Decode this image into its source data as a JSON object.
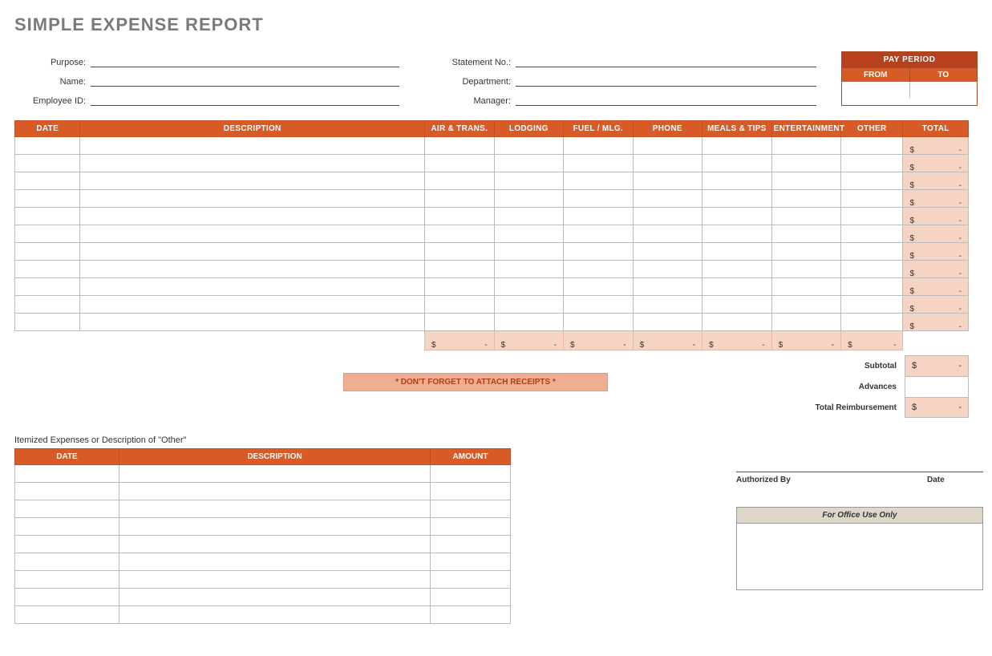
{
  "title": "SIMPLE EXPENSE REPORT",
  "meta": {
    "left": [
      {
        "label": "Purpose:"
      },
      {
        "label": "Name:"
      },
      {
        "label": "Employee ID:"
      }
    ],
    "right": [
      {
        "label": "Statement No.:"
      },
      {
        "label": "Department:"
      },
      {
        "label": "Manager:"
      }
    ]
  },
  "pay_period": {
    "title": "PAY PERIOD",
    "from_label": "FROM",
    "to_label": "TO"
  },
  "main_headers": {
    "date": "DATE",
    "description": "DESCRIPTION",
    "air": "AIR & TRANS.",
    "lodging": "LODGING",
    "fuel": "FUEL / MLG.",
    "phone": "PHONE",
    "meals": "MEALS & TIPS",
    "entertainment": "ENTERTAINMENT",
    "other": "OTHER",
    "total": "TOTAL"
  },
  "currency_symbol": "$",
  "dash": "-",
  "reminder": "* DON'T FORGET TO ATTACH RECEIPTS *",
  "summary": {
    "subtotal": "Subtotal",
    "advances": "Advances",
    "total_reimbursement": "Total Reimbursement"
  },
  "itemized_title": "Itemized Expenses or Description of \"Other\"",
  "item_headers": {
    "date": "DATE",
    "description": "DESCRIPTION",
    "amount": "AMOUNT"
  },
  "auth": {
    "by": "Authorized By",
    "date": "Date"
  },
  "office_use": "For Office Use Only"
}
